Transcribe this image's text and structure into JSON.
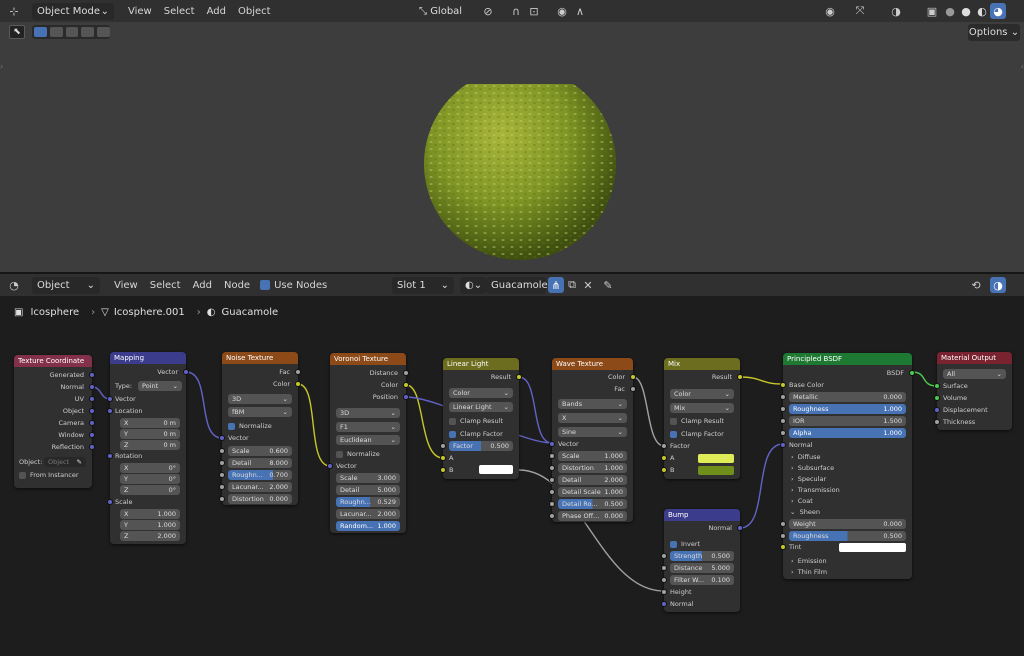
{
  "viewport": {
    "mode": "Object Mode",
    "menu": [
      "View",
      "Select",
      "Add",
      "Object"
    ],
    "orientation": "Global",
    "options": "Options"
  },
  "node_editor": {
    "type": "Object",
    "menu": [
      "View",
      "Select",
      "Add",
      "Node"
    ],
    "use_nodes": "Use Nodes",
    "slot": "Slot 1",
    "material": "Guacamole",
    "breadcrumb": [
      "Icosphere",
      "Icosphere.001",
      "Guacamole"
    ]
  },
  "nodes": {
    "texcoord": {
      "title": "Texture Coordinate",
      "outputs": [
        "Generated",
        "Normal",
        "UV",
        "Object",
        "Camera",
        "Window",
        "Reflection"
      ],
      "object_label": "Object:",
      "object_field": "Object",
      "from_instancer": "From Instancer"
    },
    "mapping": {
      "title": "Mapping",
      "out": "Vector",
      "type_label": "Type:",
      "type": "Point",
      "in_vector": "Vector",
      "location": "Location",
      "rotation": "Rotation",
      "scale": "Scale",
      "loc": [
        [
          "X",
          "0 m"
        ],
        [
          "Y",
          "0 m"
        ],
        [
          "Z",
          "0 m"
        ]
      ],
      "rot": [
        [
          "X",
          "0°"
        ],
        [
          "Y",
          "0°"
        ],
        [
          "Z",
          "0°"
        ]
      ],
      "scl": [
        [
          "X",
          "1.000"
        ],
        [
          "Y",
          "1.000"
        ],
        [
          "Z",
          "2.000"
        ]
      ]
    },
    "noise": {
      "title": "Noise Texture",
      "fac": "Fac",
      "color": "Color",
      "dim": "3D",
      "type": "fBM",
      "normalize": "Normalize",
      "vector": "Vector",
      "fields": [
        [
          "Scale",
          "0.600"
        ],
        [
          "Detail",
          "8.000"
        ],
        [
          "Roughn...",
          "0.700"
        ],
        [
          "Lacunar...",
          "2.000"
        ],
        [
          "Distortion",
          "0.000"
        ]
      ]
    },
    "voronoi": {
      "title": "Voronoi Texture",
      "distance": "Distance",
      "color": "Color",
      "position": "Position",
      "dim": "3D",
      "feature": "F1",
      "metric": "Euclidean",
      "normalize": "Normalize",
      "vector": "Vector",
      "fields": [
        [
          "Scale",
          "3.000"
        ],
        [
          "Detail",
          "5.000"
        ],
        [
          "Roughn...",
          "0.529"
        ],
        [
          "Lacunar...",
          "2.000"
        ],
        [
          "Random...",
          "1.000"
        ]
      ]
    },
    "linear": {
      "title": "Linear Light",
      "result": "Result",
      "dtype": "Color",
      "blend": "Linear Light",
      "clamp_result": "Clamp Result",
      "clamp_factor": "Clamp Factor",
      "factor": "Factor",
      "factor_val": "0.500",
      "a": "A",
      "b": "B"
    },
    "wave": {
      "title": "Wave Texture",
      "color": "Color",
      "fac": "Fac",
      "type": "Bands",
      "dir": "X",
      "profile": "Sine",
      "vector": "Vector",
      "fields": [
        [
          "Scale",
          "1.000"
        ],
        [
          "Distortion",
          "1.000"
        ],
        [
          "Detail",
          "2.000"
        ],
        [
          "Detail Scale",
          "1.000"
        ],
        [
          "Detail Ro...",
          "0.500"
        ],
        [
          "Phase Off...",
          "0.000"
        ]
      ]
    },
    "mix": {
      "title": "Mix",
      "result": "Result",
      "dtype": "Color",
      "blend": "Mix",
      "clamp_result": "Clamp Result",
      "clamp_factor": "Clamp Factor",
      "factor": "Factor",
      "a": "A",
      "b": "B",
      "color_a": "#dfec58",
      "color_b": "#6f8f1a"
    },
    "bump": {
      "title": "Bump",
      "normal_out": "Normal",
      "invert": "Invert",
      "fields": [
        [
          "Strength",
          "0.500"
        ],
        [
          "Distance",
          "5.000"
        ],
        [
          "Filter W...",
          "0.100"
        ]
      ],
      "height": "Height",
      "normal_in": "Normal"
    },
    "bsdf": {
      "title": "Principled BSDF",
      "out": "BSDF",
      "base_color": "Base Color",
      "fields": [
        [
          "Metallic",
          "0.000"
        ],
        [
          "Roughness",
          "1.000"
        ],
        [
          "IOR",
          "1.500"
        ],
        [
          "Alpha",
          "1.000"
        ]
      ],
      "normal": "Normal",
      "sections": [
        "Diffuse",
        "Subsurface",
        "Specular",
        "Transmission",
        "Coat",
        "Sheen"
      ],
      "sheen": [
        [
          "Weight",
          "0.000"
        ],
        [
          "Roughness",
          "0.500"
        ]
      ],
      "tint": "Tint",
      "more": [
        "Emission",
        "Thin Film"
      ]
    },
    "output": {
      "title": "Material Output",
      "target": "All",
      "inputs": [
        "Surface",
        "Volume",
        "Displacement",
        "Thickness"
      ]
    }
  },
  "colors": {
    "accent": "#4772b3",
    "tex_header": "#8c4a18",
    "vec_header": "#3c3c8c",
    "shader_header": "#1e7a33",
    "output_header": "#7a2330",
    "input_header": "#83314a",
    "color_header": "#6d6d1f"
  }
}
